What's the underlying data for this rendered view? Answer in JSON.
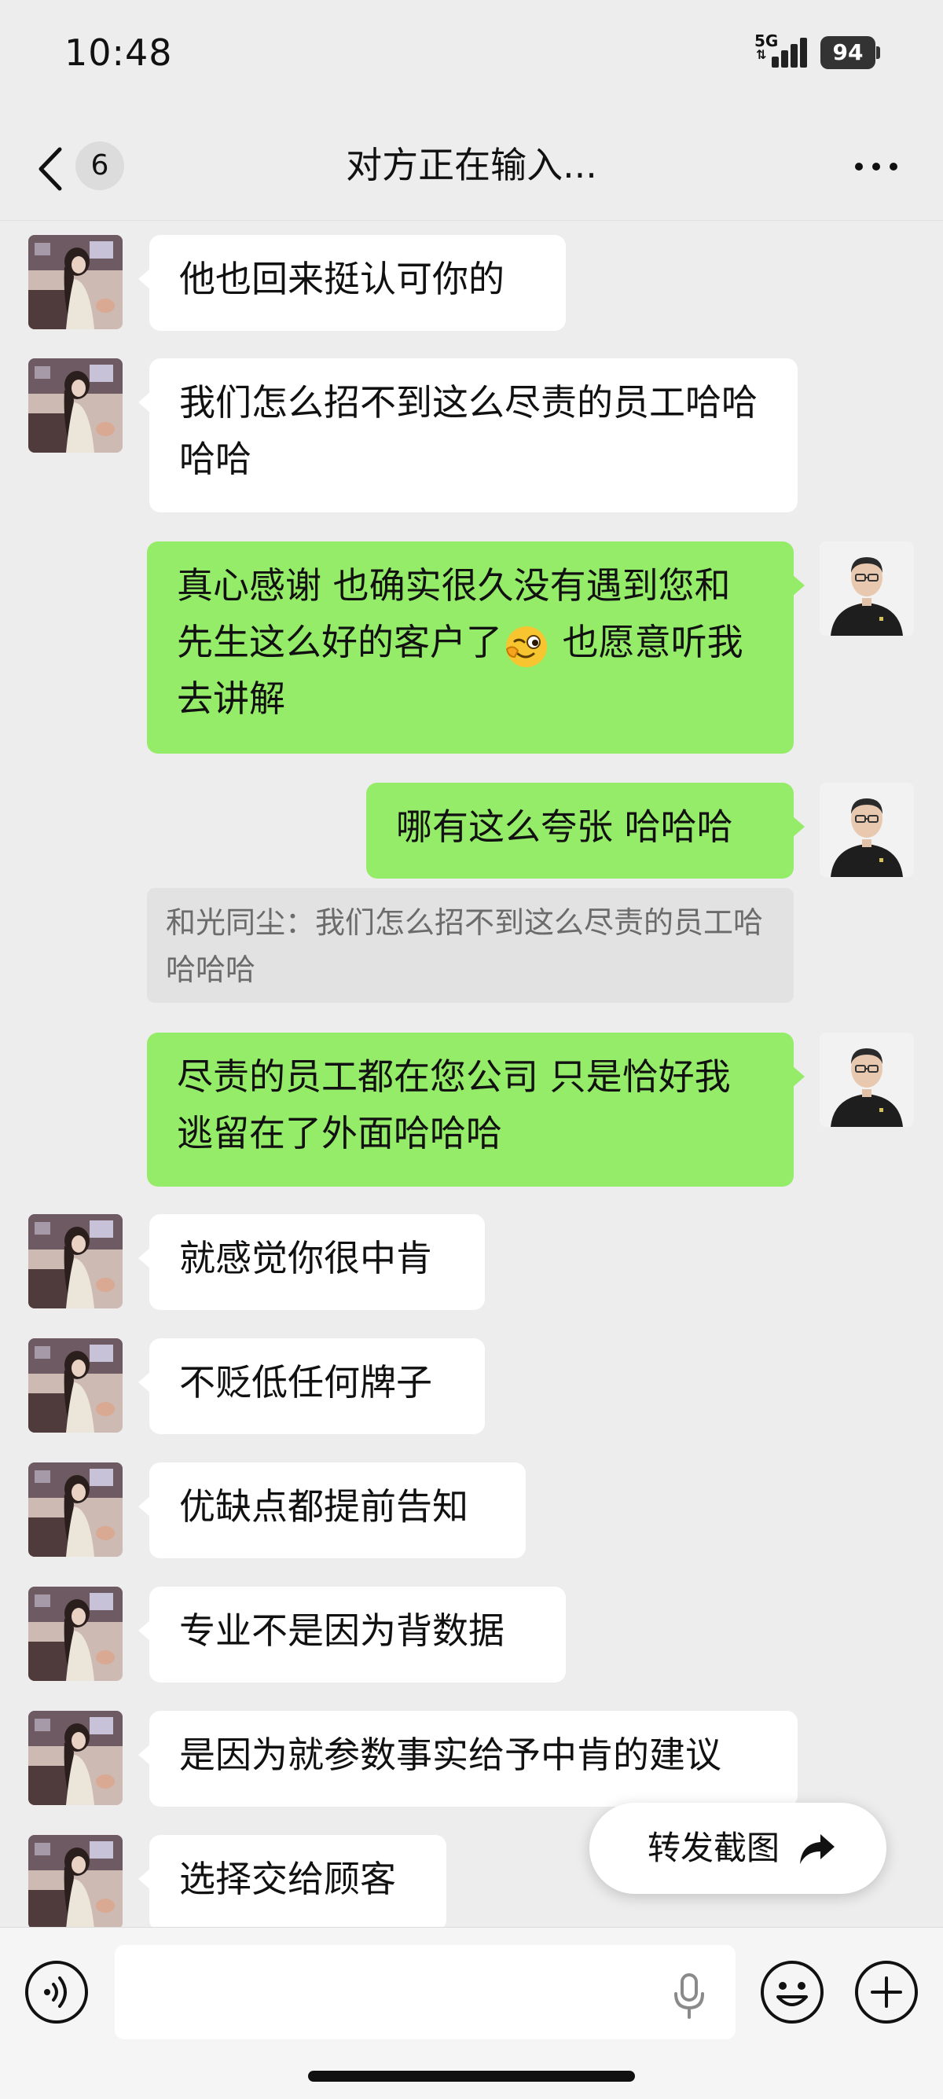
{
  "status_bar": {
    "time": "10:48",
    "network": "5G",
    "battery": "94"
  },
  "header": {
    "unread_count": "6",
    "title": "对方正在输入..."
  },
  "messages": [
    {
      "side": "left",
      "text": "他也回来挺认可你的"
    },
    {
      "side": "left",
      "text": "我们怎么招不到这么尽责的员工哈哈哈哈"
    },
    {
      "side": "right",
      "text_before": "真心感谢  也确实很久没有遇到您和先生这么好的客户了",
      "text_after": " 也愿意听我去讲解",
      "emoji": "wink-face-emoji"
    },
    {
      "side": "right",
      "text": "哪有这么夸张 哈哈哈"
    },
    {
      "side": "right",
      "text": "尽责的员工都在您公司 只是恰好我逃留在了外面哈哈哈"
    },
    {
      "side": "left",
      "text": "就感觉你很中肯"
    },
    {
      "side": "left",
      "text": "不贬低任何牌子"
    },
    {
      "side": "left",
      "text": "优缺点都提前告知"
    },
    {
      "side": "left",
      "text": "专业不是因为背数据"
    },
    {
      "side": "left",
      "text": "是因为就参数事实给予中肯的建议"
    },
    {
      "side": "left",
      "text": "选择交给顾客"
    }
  ],
  "quote": {
    "text": "和光同尘：我们怎么招不到这么尽责的员工哈哈哈哈"
  },
  "forward_button": {
    "label": "转发截图"
  },
  "colors": {
    "background": "#ededed",
    "sent_bubble": "#95ec69",
    "received_bubble": "#ffffff"
  }
}
